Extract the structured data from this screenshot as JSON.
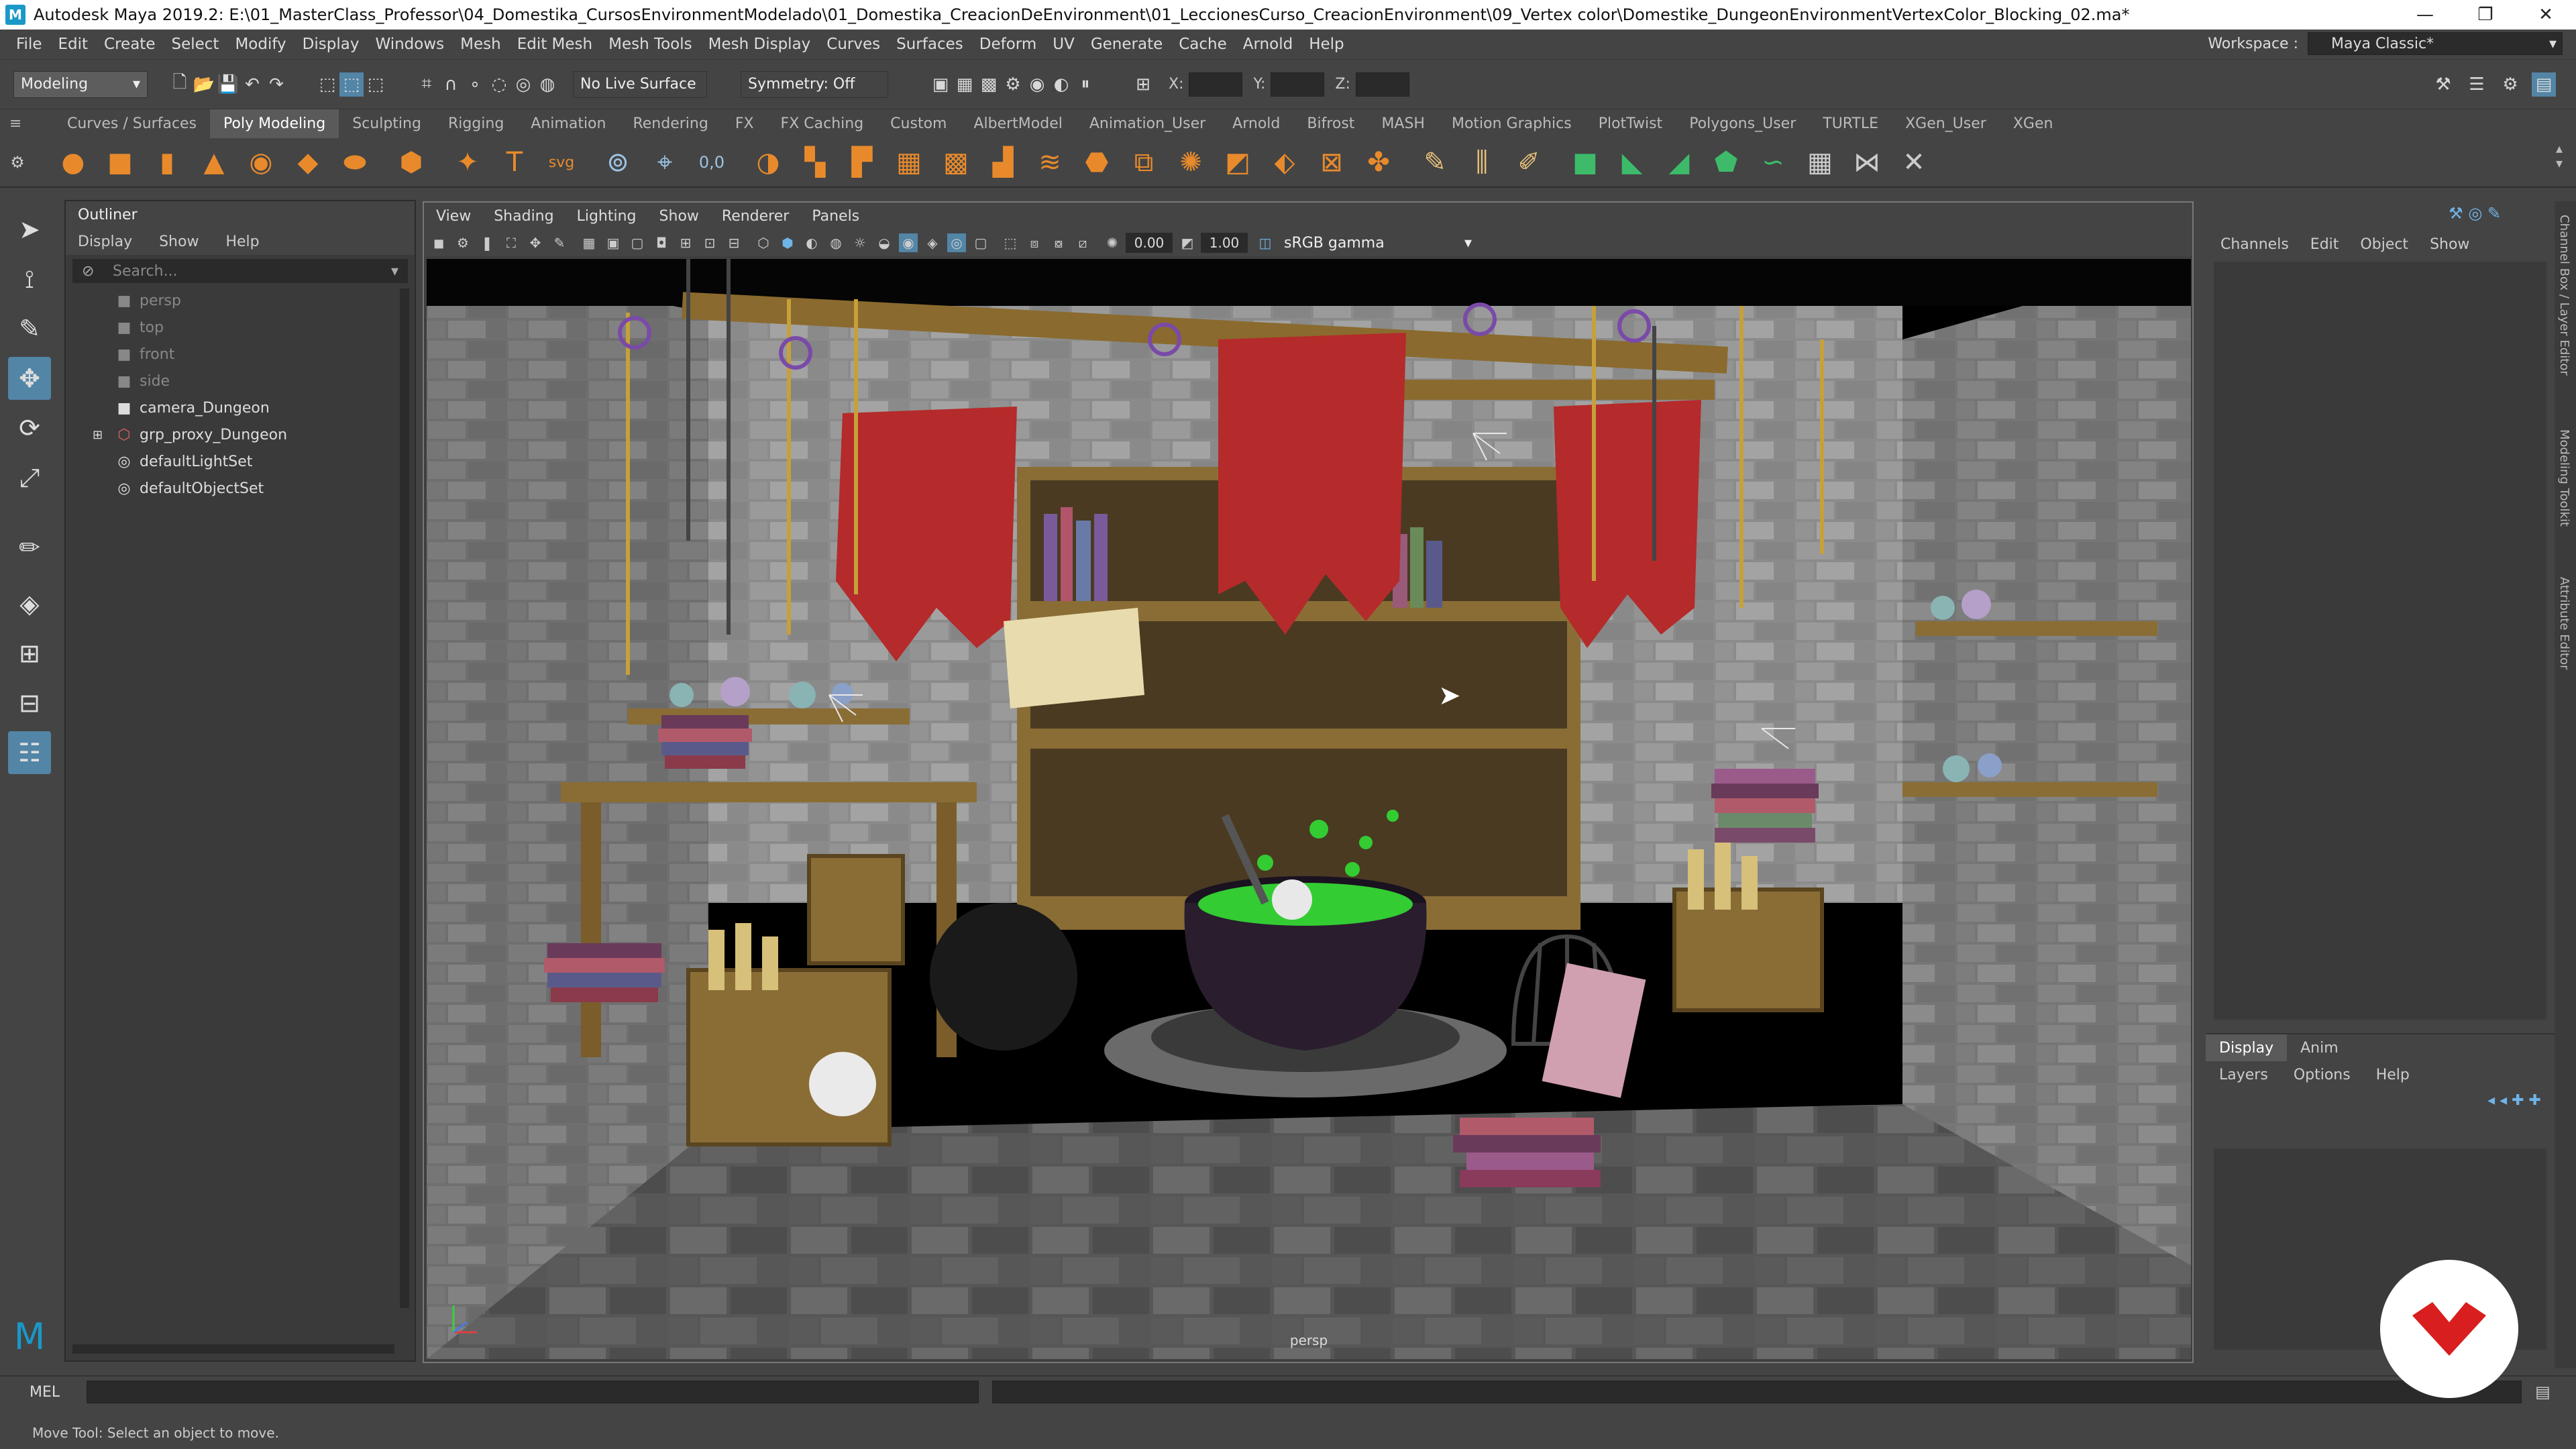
{
  "title": "Autodesk Maya 2019.2: E:\\01_MasterClass_Professor\\04_Domestika_CursosEnvironmentModelado\\01_Domestika_CreacionDeEnvironment\\01_LeccionesCurso_CreacionEnvironment\\09_Vertex color\\Domestike_DungeonEnvironmentVertexColor_Blocking_02.ma*",
  "menus": [
    "File",
    "Edit",
    "Create",
    "Select",
    "Modify",
    "Display",
    "Windows",
    "Mesh",
    "Edit Mesh",
    "Mesh Tools",
    "Mesh Display",
    "Curves",
    "Surfaces",
    "Deform",
    "UV",
    "Generate",
    "Cache",
    "Arnold",
    "Help"
  ],
  "workspace": {
    "label": "Workspace :",
    "value": "Maya Classic*"
  },
  "status": {
    "menuset": "Modeling",
    "live_surface": "No Live Surface",
    "symmetry": "Symmetry: Off",
    "x_label": "X:",
    "y_label": "Y:",
    "z_label": "Z:"
  },
  "shelf_tabs": [
    "Curves / Surfaces",
    "Poly Modeling",
    "Sculpting",
    "Rigging",
    "Animation",
    "Rendering",
    "FX",
    "FX Caching",
    "Custom",
    "AlbertModel",
    "Animation_User",
    "Arnold",
    "Bifrost",
    "MASH",
    "Motion Graphics",
    "PlotTwist",
    "Polygons_User",
    "TURTLE",
    "XGen_User",
    "XGen"
  ],
  "shelf_active": "Poly Modeling",
  "shelf_icons": [
    "sphere-icon",
    "cube-icon",
    "cylinder-icon",
    "cone-icon",
    "torus-icon",
    "plane-icon",
    "disc-icon",
    "platonic-icon",
    "star-icon",
    "text-icon",
    "svg-icon",
    "mesh-tool-icon",
    "uv-icon",
    "coords-icon",
    "combine-icon",
    "separate-icon",
    "smooth-icon",
    "extrude-icon",
    "bridge-icon",
    "bevel-icon",
    "insert-loop-icon",
    "multicut-icon",
    "target-weld-icon",
    "connect-icon",
    "merge-icon",
    "fill-hole-icon",
    "collapse-icon",
    "slide-icon",
    "spin-icon",
    "flip-icon",
    "cut-icon",
    "wedge-icon",
    "bend-icon",
    "crease-icon",
    "uv-editor-icon",
    "unfold-icon",
    "layout-icon",
    "sew-icon",
    "cut-uv-icon",
    "transfer-icon",
    "cleanup-icon",
    "triangulate-icon",
    "quadrangulate-icon",
    "mirror-icon",
    "geometry-icon",
    "relax-icon"
  ],
  "outliner": {
    "title": "Outliner",
    "menu": [
      "Display",
      "Show",
      "Help"
    ],
    "search_placeholder": "Search...",
    "items": [
      {
        "label": "persp",
        "icon": "camera-icon",
        "dim": true
      },
      {
        "label": "top",
        "icon": "camera-icon",
        "dim": true
      },
      {
        "label": "front",
        "icon": "camera-icon",
        "dim": true
      },
      {
        "label": "side",
        "icon": "camera-icon",
        "dim": true
      },
      {
        "label": "camera_Dungeon",
        "icon": "camera-icon",
        "dim": false
      },
      {
        "label": "grp_proxy_Dungeon",
        "icon": "group-icon",
        "dim": false
      },
      {
        "label": "defaultLightSet",
        "icon": "set-icon",
        "dim": false
      },
      {
        "label": "defaultObjectSet",
        "icon": "set-icon",
        "dim": false
      }
    ]
  },
  "viewport": {
    "menu": [
      "View",
      "Shading",
      "Lighting",
      "Show",
      "Renderer",
      "Panels"
    ],
    "exposure": "0.00",
    "gamma": "1.00",
    "colorspace": "sRGB gamma",
    "camera_label": "persp"
  },
  "channelbox": {
    "menu": [
      "Channels",
      "Edit",
      "Object",
      "Show"
    ]
  },
  "layereditor": {
    "tabs": [
      "Display",
      "Anim"
    ],
    "active_tab": "Display",
    "menu": [
      "Layers",
      "Options",
      "Help"
    ]
  },
  "sidetabs": [
    "Channel Box / Layer Editor",
    "Modeling Toolkit",
    "Attribute Editor"
  ],
  "cmdline": {
    "label": "MEL"
  },
  "helpline": "Move Tool: Select an object to move.",
  "colors": {
    "accent": "#5285a6",
    "panel": "#444444",
    "banner": "#b52a2a",
    "cauldron": "#2a1d2e",
    "potion": "#33cc33"
  }
}
